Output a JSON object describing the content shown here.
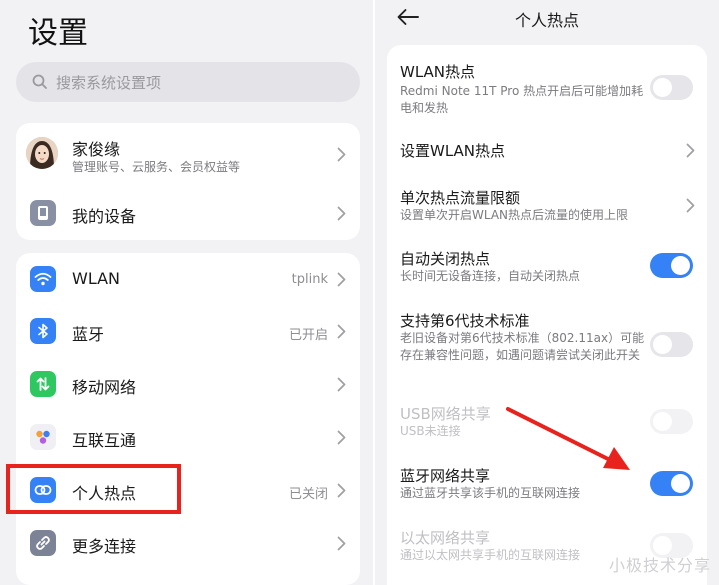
{
  "settings": {
    "title": "设置",
    "search_placeholder": "搜索系统设置项",
    "account": {
      "name": "家俊缘",
      "subtitle": "管理账号、云服务、会员权益等"
    },
    "my_device": "我的设备",
    "items": [
      {
        "label": "WLAN",
        "value": "tplink",
        "icon": "wifi-icon",
        "color": "#3482f5"
      },
      {
        "label": "蓝牙",
        "value": "已开启",
        "icon": "bluetooth-icon",
        "color": "#3482f5"
      },
      {
        "label": "移动网络",
        "value": "",
        "icon": "mobile-network-icon",
        "color": "#2ec760"
      },
      {
        "label": "互联互通",
        "value": "",
        "icon": "interconnect-icon",
        "color": "#f0f0f4"
      },
      {
        "label": "个人热点",
        "value": "已关闭",
        "icon": "hotspot-icon",
        "color": "#3482f5"
      },
      {
        "label": "更多连接",
        "value": "",
        "icon": "link-icon",
        "color": "#7d8397"
      }
    ]
  },
  "hotspot": {
    "title": "个人热点",
    "items": [
      {
        "title": "WLAN热点",
        "subtitle": "Redmi Note 11T Pro 热点开启后可能增加耗电和发热",
        "control": "toggle",
        "state": "off"
      },
      {
        "title": "设置WLAN热点",
        "subtitle": "",
        "control": "chevron"
      },
      {
        "title": "单次热点流量限额",
        "subtitle": "设置单次开启WLAN热点后流量的使用上限",
        "control": "chevron"
      },
      {
        "title": "自动关闭热点",
        "subtitle": "长时间无设备连接，自动关闭热点",
        "control": "toggle",
        "state": "on"
      },
      {
        "title": "支持第6代技术标准",
        "subtitle": "老旧设备对第6代技术标准（802.11ax）可能存在兼容性问题，如遇问题请尝试关闭此开关",
        "control": "toggle",
        "state": "off"
      },
      {
        "title": "USB网络共享",
        "subtitle": "USB未连接",
        "control": "toggle",
        "state": "disabled"
      },
      {
        "title": "蓝牙网络共享",
        "subtitle": "通过蓝牙共享该手机的互联网连接",
        "control": "toggle",
        "state": "on"
      },
      {
        "title": "以太网络共享",
        "subtitle": "通过以太网共享手机的互联网连接",
        "control": "toggle",
        "state": "disabled"
      }
    ]
  },
  "watermark": "小极技术分享",
  "colors": {
    "accent": "#3482f5",
    "annotation": "#e8221c"
  }
}
